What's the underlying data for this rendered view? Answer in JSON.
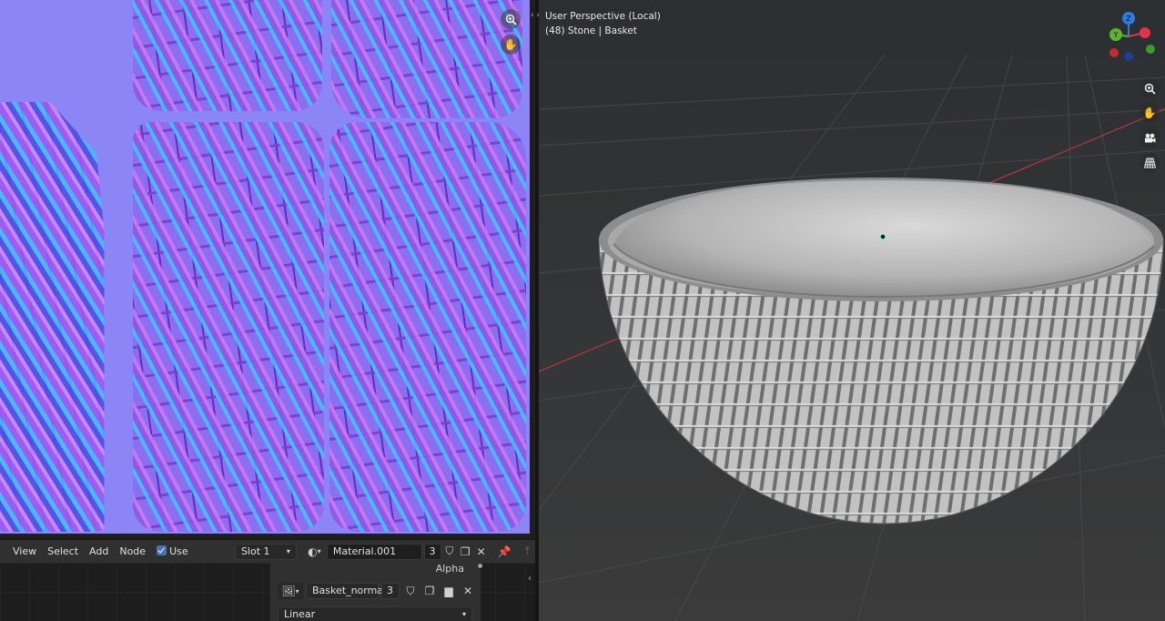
{
  "viewport": {
    "perspective_label": "User Perspective (Local)",
    "object_info": "(48) Stone | Basket",
    "gizmo": {
      "y_label": "Y",
      "z_label": "Z"
    },
    "tools": [
      "zoom-icon",
      "pan-hand-icon",
      "camera-icon",
      "grid-icon"
    ]
  },
  "image_editor": {
    "tools": [
      "zoom-icon",
      "pan-hand-icon"
    ]
  },
  "node_editor": {
    "menu": {
      "view": "View",
      "select": "Select",
      "add": "Add",
      "node": "Node"
    },
    "use_nodes_label": "Use Nodes",
    "slot": "Slot 1",
    "material": "Material.001",
    "material_users": "3",
    "node": {
      "output_alpha": "Alpha",
      "image_name": "Basket_normal",
      "image_users": "3",
      "color_space": "Linear"
    }
  },
  "colors": {
    "normal_map_bg": "#8c85f5",
    "viewport_bg": "#3d3d3d",
    "accent_blue": "#4772b3",
    "axis_x": "#e2334b",
    "axis_y": "#5cb531",
    "axis_z": "#2f7be2"
  }
}
